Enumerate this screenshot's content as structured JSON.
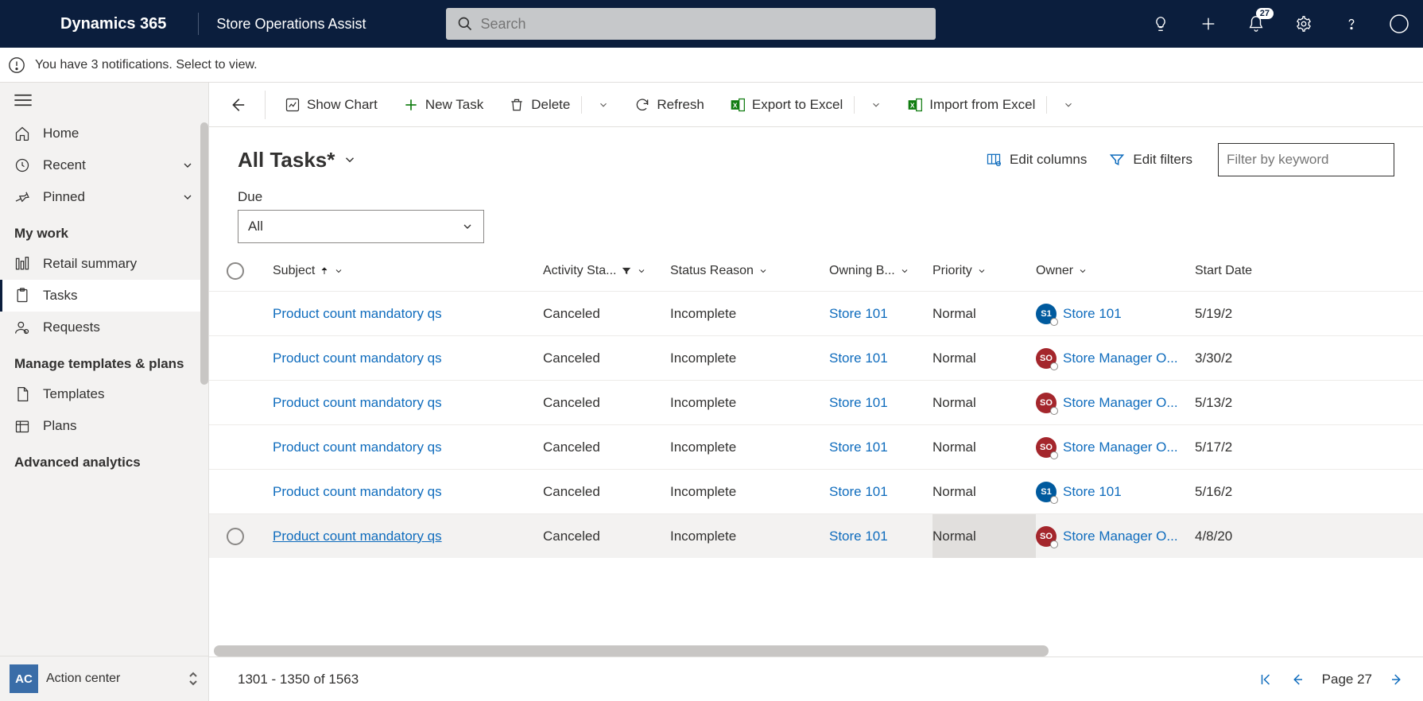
{
  "header": {
    "brand": "Dynamics 365",
    "app_name": "Store Operations Assist",
    "search_placeholder": "Search",
    "notification_count": "27"
  },
  "notification_bar": {
    "message": "You have 3 notifications. Select to view."
  },
  "sidebar": {
    "home": "Home",
    "recent": "Recent",
    "pinned": "Pinned",
    "group_my_work": "My work",
    "retail_summary": "Retail summary",
    "tasks": "Tasks",
    "requests": "Requests",
    "group_templates": "Manage templates & plans",
    "templates": "Templates",
    "plans": "Plans",
    "group_analytics": "Advanced analytics",
    "action_center": "Action center",
    "avatar_initials": "AC"
  },
  "commands": {
    "show_chart": "Show Chart",
    "new_task": "New Task",
    "delete": "Delete",
    "refresh": "Refresh",
    "export": "Export to Excel",
    "import": "Import from Excel"
  },
  "view": {
    "title": "All Tasks*",
    "edit_columns": "Edit columns",
    "edit_filters": "Edit filters",
    "filter_placeholder": "Filter by keyword",
    "due_label": "Due",
    "due_value": "All"
  },
  "columns": {
    "subject": "Subject",
    "activity_status": "Activity Sta...",
    "status_reason": "Status Reason",
    "owning_bu": "Owning B...",
    "priority": "Priority",
    "owner": "Owner",
    "start_date": "Start Date"
  },
  "rows": [
    {
      "subject": "Product count mandatory qs",
      "activity_status": "Canceled",
      "status_reason": "Incomplete",
      "owning_bu": "Store 101",
      "priority": "Normal",
      "owner_badge": "S1",
      "owner_color": "blue",
      "owner": "Store 101",
      "start_date": "5/19/2"
    },
    {
      "subject": "Product count mandatory qs",
      "activity_status": "Canceled",
      "status_reason": "Incomplete",
      "owning_bu": "Store 101",
      "priority": "Normal",
      "owner_badge": "SO",
      "owner_color": "red",
      "owner": "Store Manager O...",
      "start_date": "3/30/2"
    },
    {
      "subject": "Product count mandatory qs",
      "activity_status": "Canceled",
      "status_reason": "Incomplete",
      "owning_bu": "Store 101",
      "priority": "Normal",
      "owner_badge": "SO",
      "owner_color": "red",
      "owner": "Store Manager O...",
      "start_date": "5/13/2"
    },
    {
      "subject": "Product count mandatory qs",
      "activity_status": "Canceled",
      "status_reason": "Incomplete",
      "owning_bu": "Store 101",
      "priority": "Normal",
      "owner_badge": "SO",
      "owner_color": "red",
      "owner": "Store Manager O...",
      "start_date": "5/17/2"
    },
    {
      "subject": "Product count mandatory qs",
      "activity_status": "Canceled",
      "status_reason": "Incomplete",
      "owning_bu": "Store 101",
      "priority": "Normal",
      "owner_badge": "S1",
      "owner_color": "blue",
      "owner": "Store 101",
      "start_date": "5/16/2"
    },
    {
      "subject": "Product count mandatory qs",
      "activity_status": "Canceled",
      "status_reason": "Incomplete",
      "owning_bu": "Store 101",
      "priority": "Normal",
      "owner_badge": "SO",
      "owner_color": "red",
      "owner": "Store Manager O...",
      "start_date": "4/8/20"
    }
  ],
  "footer": {
    "range": "1301 - 1350 of 1563",
    "page_label": "Page 27"
  }
}
